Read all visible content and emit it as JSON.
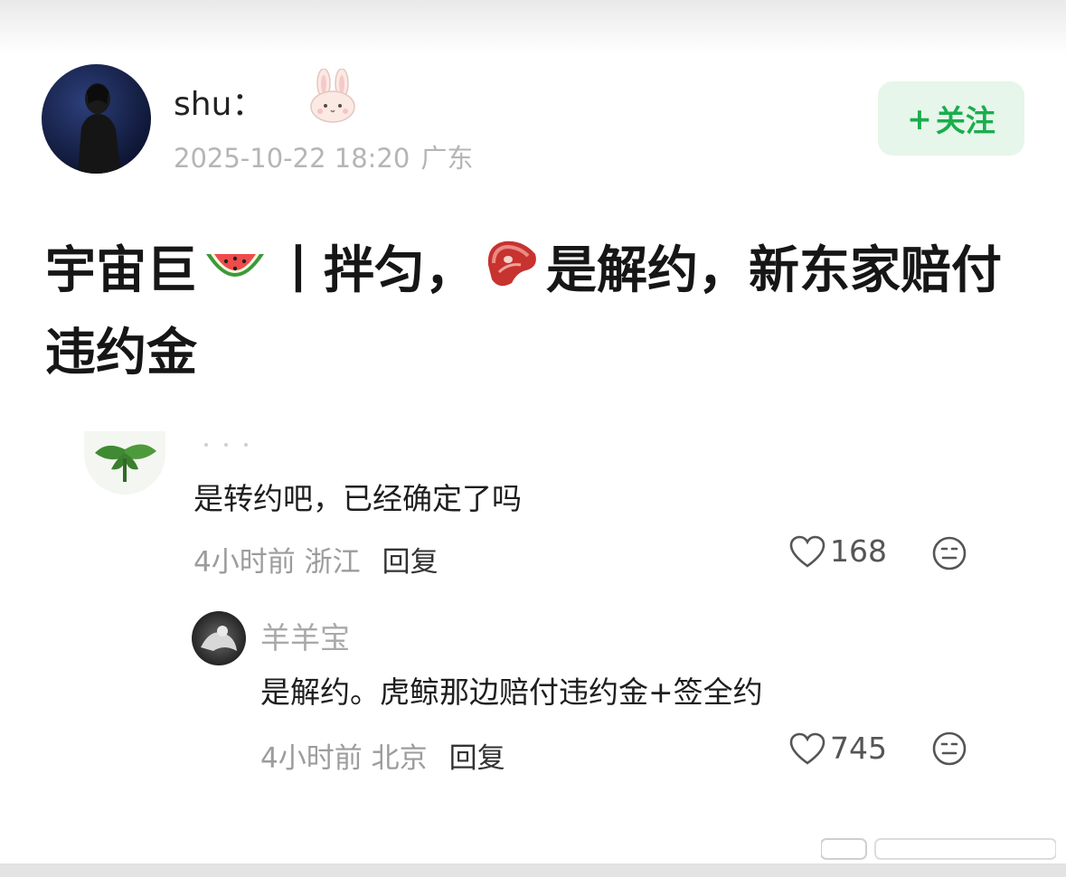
{
  "post": {
    "author": "shu：",
    "timestamp": "2025-10-22 18:20",
    "location": "广东",
    "follow_label": "关注",
    "follow_plus": "+",
    "title_parts": [
      "宇宙巨",
      "丨拌匀，",
      "是解约，新东家赔付违约金"
    ],
    "title_emojis": [
      "watermelon",
      "steak"
    ]
  },
  "comments": [
    {
      "text": "是转约吧，已经确定了吗",
      "time": "4小时前",
      "location": "浙江",
      "reply_label": "回复",
      "likes": "168"
    },
    {
      "username": "羊羊宝",
      "text": "是解约。虎鲸那边赔付违约金+签全约",
      "time": "4小时前",
      "location": "北京",
      "reply_label": "回复",
      "likes": "745"
    }
  ],
  "colors": {
    "follow_green": "#1aad4d",
    "follow_bg": "#e6f6ea",
    "meta_gray": "#9c9c9c"
  },
  "icons": [
    "bunny-emoji-icon",
    "watermelon-emoji-icon",
    "steak-emoji-icon",
    "heart-icon",
    "emoji-face-icon",
    "plant-avatar-icon"
  ]
}
